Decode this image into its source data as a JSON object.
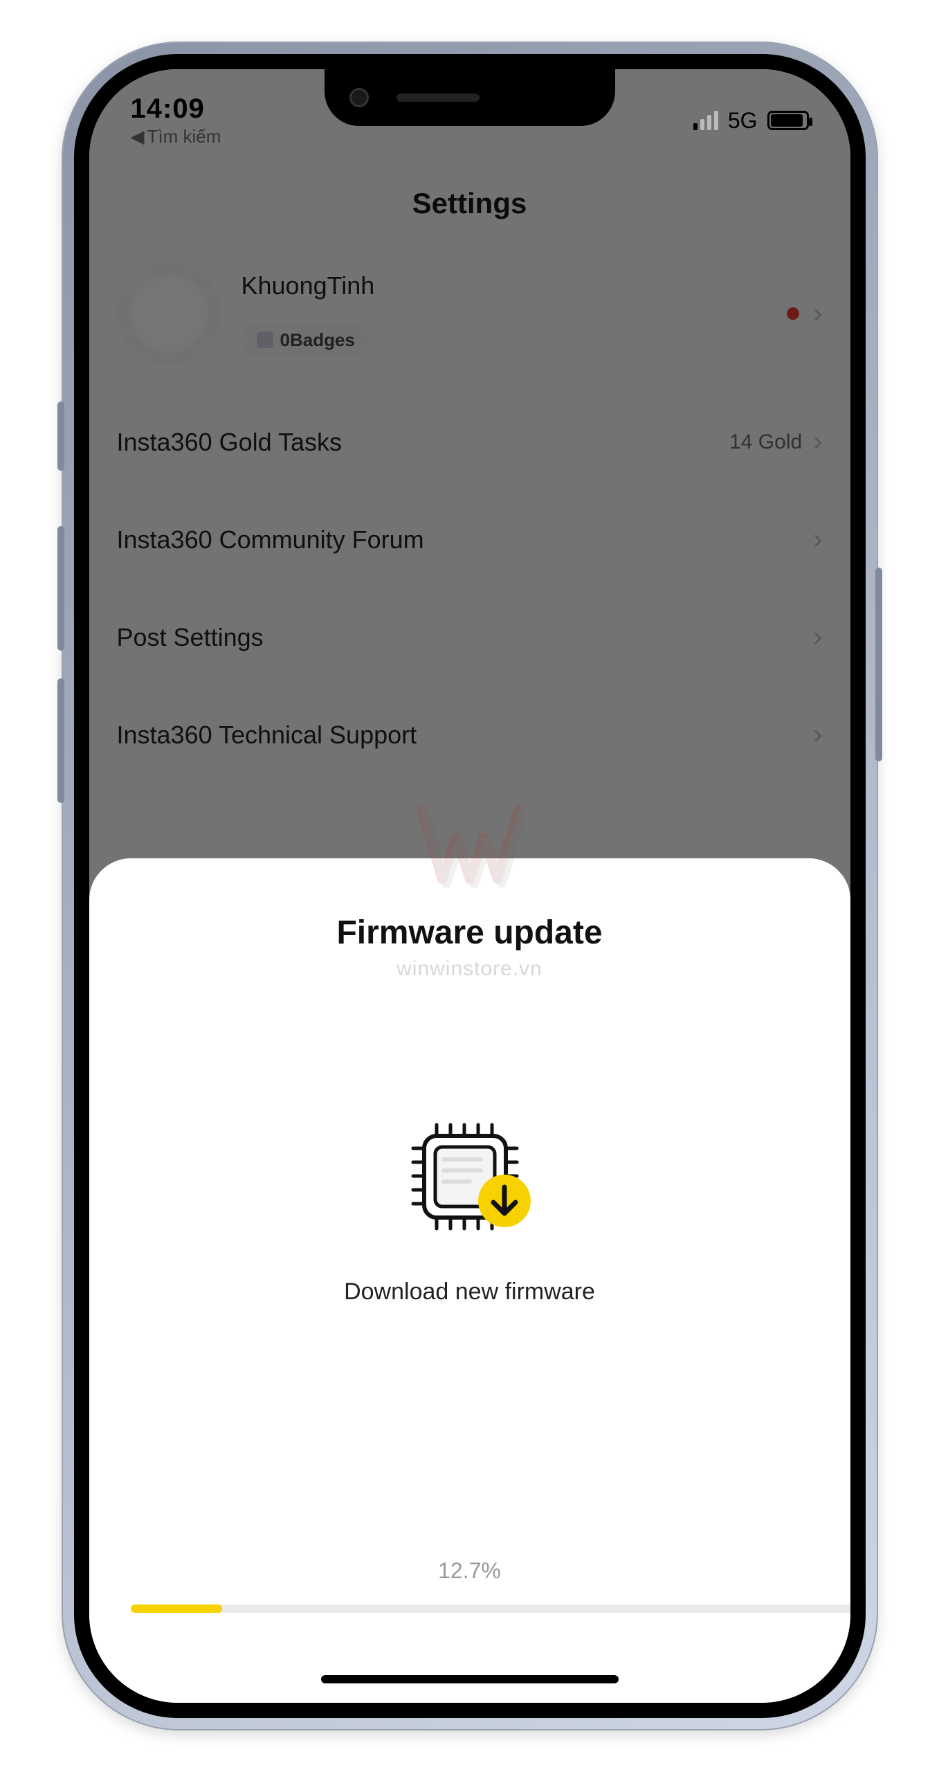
{
  "status": {
    "time": "14:09",
    "back_label": "Tìm kiếm",
    "network": "5G"
  },
  "page": {
    "title": "Settings"
  },
  "profile": {
    "username": "KhuongTinh",
    "badges_label": "0Badges"
  },
  "rows": {
    "gold_tasks": {
      "label": "Insta360 Gold Tasks",
      "value": "14 Gold"
    },
    "forum": {
      "label": "Insta360 Community Forum"
    },
    "post_settings": {
      "label": "Post Settings"
    },
    "tech_support": {
      "label": "Insta360 Technical Support"
    }
  },
  "sheet": {
    "title": "Firmware update",
    "watermark": "winwinstore.vn",
    "download_label": "Download new firmware",
    "percent": "12.7%",
    "progress_width": "12.7%"
  }
}
